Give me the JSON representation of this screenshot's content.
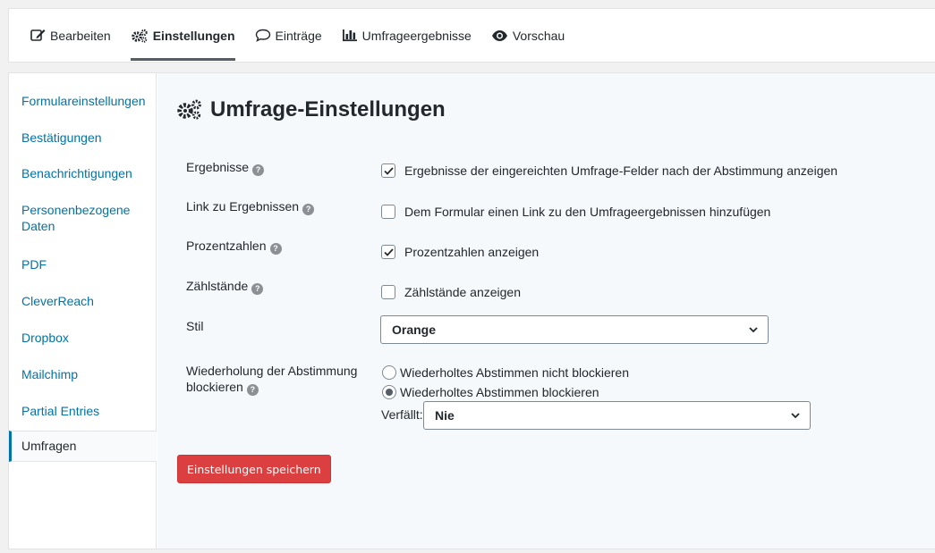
{
  "tabs": [
    {
      "label": "Bearbeiten",
      "icon": "edit-icon"
    },
    {
      "label": "Einstellungen",
      "icon": "gears-icon"
    },
    {
      "label": "Einträge",
      "icon": "comment-icon"
    },
    {
      "label": "Umfrageergebnisse",
      "icon": "bar-chart-icon"
    },
    {
      "label": "Vorschau",
      "icon": "eye-icon"
    }
  ],
  "sidebar": {
    "items": [
      {
        "label": "Formulareinstellungen"
      },
      {
        "label": "Bestätigungen"
      },
      {
        "label": "Benachrichtigungen"
      },
      {
        "label": "Personenbezogene Daten"
      },
      {
        "label": "PDF"
      },
      {
        "label": "CleverReach"
      },
      {
        "label": "Dropbox"
      },
      {
        "label": "Mailchimp"
      },
      {
        "label": "Partial Entries"
      },
      {
        "label": "Umfragen"
      }
    ],
    "active": "Umfragen"
  },
  "page": {
    "title": "Umfrage-Einstellungen"
  },
  "settings": {
    "results": {
      "label": "Ergebnisse",
      "option": "Ergebnisse der eingereichten Umfrage-Felder nach der Abstimmung anzeigen",
      "checked": true
    },
    "results_link": {
      "label": "Link zu Ergebnissen",
      "option": "Dem Formular einen Link zu den Umfrageergebnissen hinzufügen",
      "checked": false
    },
    "percentages": {
      "label": "Prozentzahlen",
      "option": "Prozentzahlen anzeigen",
      "checked": true
    },
    "counts": {
      "label": "Zählstände",
      "option": "Zählstände anzeigen",
      "checked": false
    },
    "style": {
      "label": "Stil",
      "value": "Orange"
    },
    "block_repeat": {
      "label": "Wiederholung der Abstimmung blockieren",
      "option_no_block": "Wiederholtes Abstimmen nicht blockieren",
      "option_block": "Wiederholtes Abstimmen blockieren",
      "selected": "block",
      "expires_label": "Verfällt:",
      "expires_value": "Nie"
    }
  },
  "save_button": "Einstellungen speichern",
  "colors": {
    "link": "#0073aa",
    "save_button": "#dc3f3f",
    "content_bg": "#f5f9fc"
  }
}
